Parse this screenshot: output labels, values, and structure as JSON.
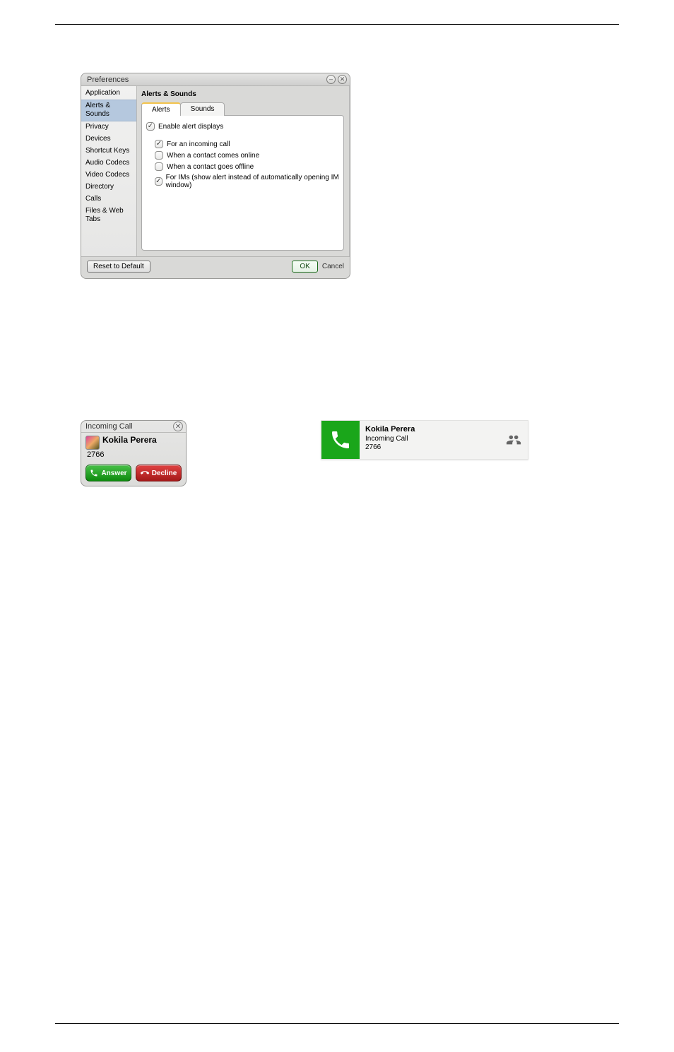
{
  "pref": {
    "title": "Preferences",
    "sidebar": [
      "Application",
      "Alerts & Sounds",
      "Privacy",
      "Devices",
      "Shortcut Keys",
      "Audio Codecs",
      "Video Codecs",
      "Directory",
      "Calls",
      "Files & Web Tabs"
    ],
    "heading": "Alerts & Sounds",
    "tabs": {
      "alerts": "Alerts",
      "sounds": "Sounds"
    },
    "enable_label": "Enable alert displays",
    "options": [
      "For an incoming call",
      "When a contact comes online",
      "When a contact goes offline",
      "For IMs (show alert instead of automatically opening IM window)"
    ],
    "reset_label": "Reset to Default",
    "ok_label": "OK",
    "cancel_label": "Cancel"
  },
  "mac_alert": {
    "title": "Incoming Call",
    "name": "Kokila Perera",
    "number": "2766",
    "answer": "Answer",
    "decline": "Decline"
  },
  "win_alert": {
    "name": "Kokila Perera",
    "sub": "Incoming Call",
    "number": "2766"
  }
}
